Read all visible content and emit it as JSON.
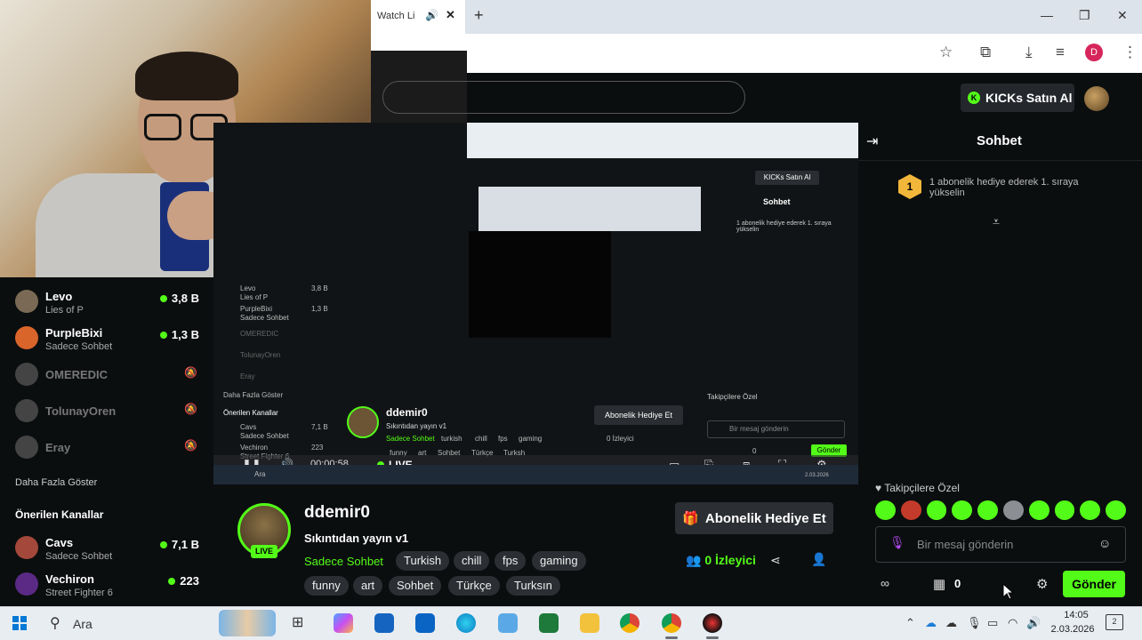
{
  "browser": {
    "tab_title": "Watch Li",
    "new_tab": "+",
    "profile_initial": "D"
  },
  "header": {
    "kicks_button": "KICKs Satın Al",
    "kicks_icon": "K"
  },
  "sidebar": {
    "followed": [
      {
        "name": "Levo",
        "sub": "Lies of P",
        "count": "3,8 B",
        "live": true
      },
      {
        "name": "PurpleBixi",
        "sub": "Sadece Sohbet",
        "count": "1,3 B",
        "live": true
      },
      {
        "name": "OMEREDIC",
        "live": false
      },
      {
        "name": "TolunayOren",
        "live": false
      },
      {
        "name": "Eray",
        "live": false
      }
    ],
    "show_more": "Daha Fazla Göster",
    "recommended_title": "Önerilen Kanallar",
    "recommended": [
      {
        "name": "Cavs",
        "sub": "Sadece Sohbet",
        "count": "7,1 B"
      },
      {
        "name": "Vechiron",
        "sub": "Street Fighter 6",
        "count": "223"
      }
    ]
  },
  "mirror": {
    "time": "00:00:58",
    "live": "LIVE",
    "name": "ddemir0",
    "title": "Sıkıntıdan yayın v1",
    "category": "Sadece Sohbet",
    "tags": [
      "turkish",
      "chill",
      "fps",
      "gaming",
      "funny",
      "art",
      "Sohbet",
      "Türkçe",
      "Turksh"
    ],
    "gift": "Abonelik Hediye Et",
    "viewers": "0 İzleyici",
    "follow_only": "Takipçilere Özel",
    "msg_placeholder": "Bir mesaj gönderin",
    "send": "Gönder",
    "chat_title": "Sohbet",
    "kicks": "KICKs Satın Al",
    "rank_text": "1 abonelik hediye ederek 1. sıraya yükselin",
    "zero": "0",
    "ara": "Ara",
    "date": "2.03.2026",
    "sidebar": [
      {
        "name": "Levo",
        "sub": "Lies of P",
        "count": "3,8 B"
      },
      {
        "name": "PurpleBixi",
        "sub": "Sadece Sohbet",
        "count": "1,3 B"
      },
      {
        "name": "OMEREDIC"
      },
      {
        "name": "TolunayOren"
      },
      {
        "name": "Eray"
      }
    ],
    "show_more": "Daha Fazla Göster",
    "recommended_title": "Önerilen Kanallar",
    "recommended": [
      {
        "name": "Cavs",
        "sub": "Sadece Sohbet",
        "count": "7,1 B"
      },
      {
        "name": "Vechiron",
        "sub": "Street Fighter 6",
        "count": "223"
      }
    ]
  },
  "stream": {
    "streamer": "ddemir0",
    "live_badge": "LIVE",
    "title": "Sıkıntıdan yayın v1",
    "category": "Sadece Sohbet",
    "tags_row1": [
      "Turkish",
      "chill",
      "fps",
      "gaming"
    ],
    "tags_row2": [
      "funny",
      "art",
      "Sohbet",
      "Türkçe",
      "Turksın"
    ],
    "gift_button": "Abonelik Hediye Et",
    "viewer_count": "0",
    "viewer_label": "İzleyici"
  },
  "chat": {
    "title": "Sohbet",
    "rank_badge": "1",
    "rank_text": "1 abonelik hediye ederek 1. sıraya yükselin",
    "follow_only": "Takipçilere Özel",
    "placeholder": "Bir mesaj gönderin",
    "store_count": "0",
    "send_button": "Gönder"
  },
  "taskbar": {
    "search_label": "Ara",
    "time": "14:05",
    "date": "2.03.2026",
    "notification_count": "2"
  },
  "colors": {
    "accent": "#53fc18",
    "background": "#0b0e0f",
    "tag_bg": "#2b2e33"
  }
}
